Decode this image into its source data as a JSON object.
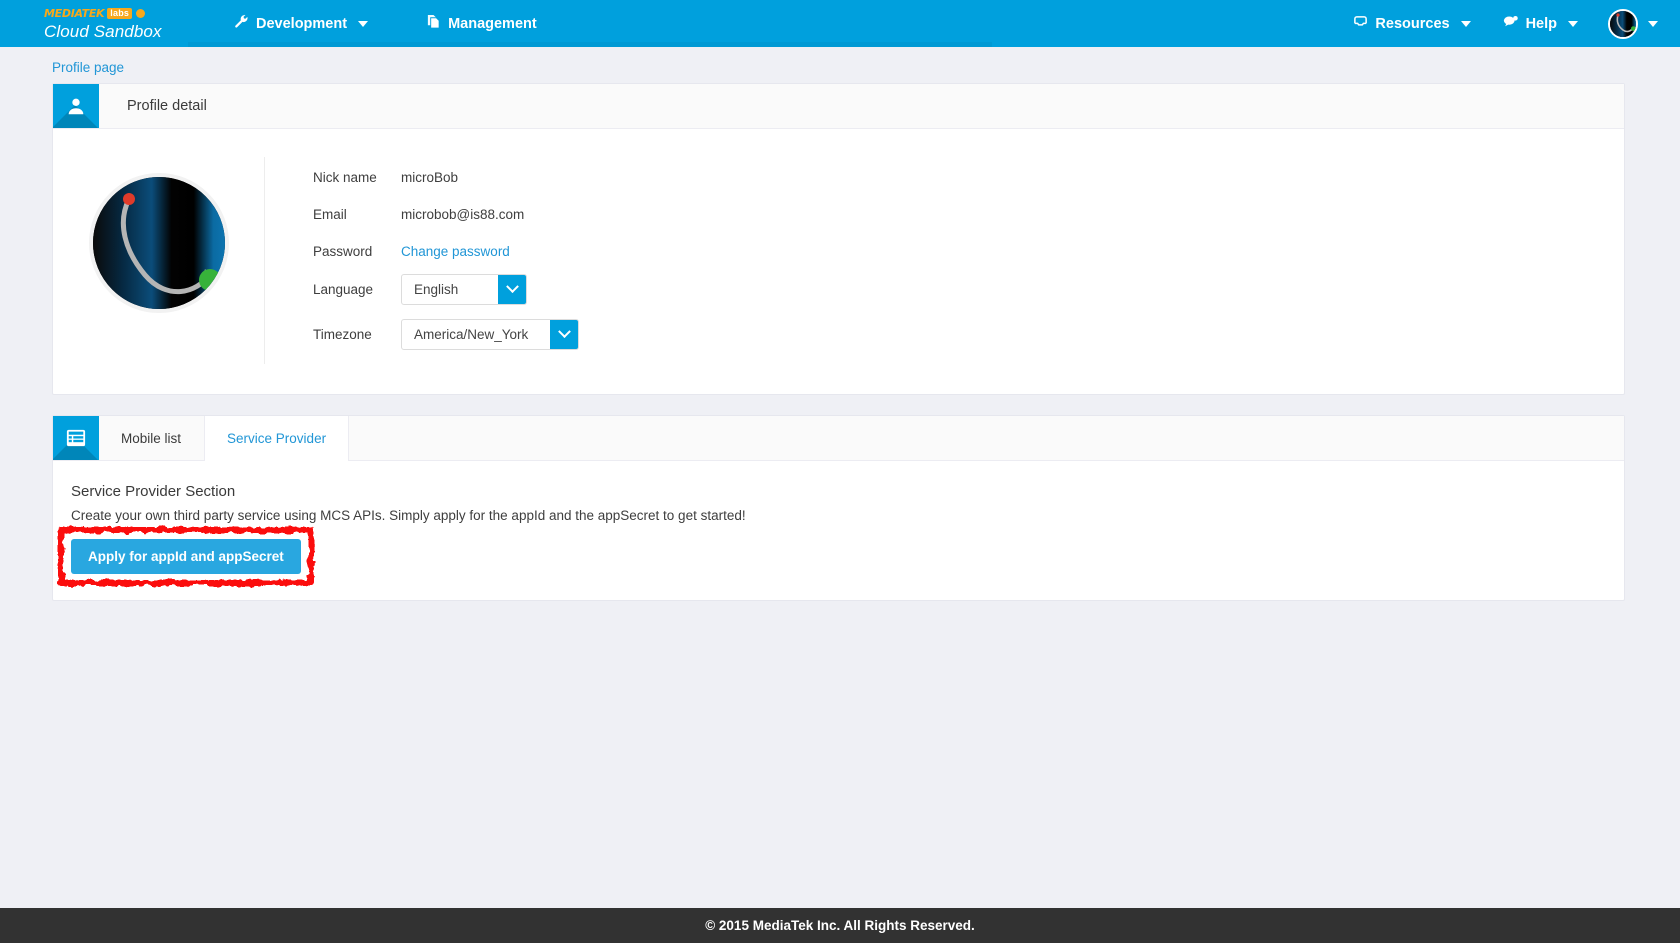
{
  "header": {
    "brand": {
      "mediatek": "MEDIATEK",
      "labs": "labs",
      "product": "Cloud Sandbox"
    },
    "nav_left": [
      {
        "label": "Development",
        "icon": "wrench-icon",
        "has_caret": true
      },
      {
        "label": "Management",
        "icon": "documents-icon",
        "has_caret": false
      }
    ],
    "nav_right": [
      {
        "label": "Resources",
        "icon": "inbox-icon",
        "has_caret": true
      },
      {
        "label": "Help",
        "icon": "chat-icon",
        "has_caret": true
      }
    ],
    "account": {
      "label": "",
      "has_caret": true
    }
  },
  "breadcrumb": {
    "label": "Profile page"
  },
  "profile_card": {
    "title": "Profile detail",
    "icon": "user-icon",
    "fields": [
      {
        "label": "Nick name",
        "type": "text",
        "value": "microBob"
      },
      {
        "label": "Email",
        "type": "text",
        "value": "microbob@is88.com"
      },
      {
        "label": "Password",
        "type": "link",
        "value": "Change password"
      },
      {
        "label": "Language",
        "type": "select",
        "value": "English"
      },
      {
        "label": "Timezone",
        "type": "select",
        "value": "America/New_York"
      }
    ]
  },
  "tabs_card": {
    "icon": "list-icon",
    "tabs": [
      {
        "label": "Mobile list",
        "active": false
      },
      {
        "label": "Service Provider",
        "active": true
      }
    ],
    "section": {
      "title": "Service Provider Section",
      "description": "Create your own third party service using MCS APIs. Simply apply for the appId and the appSecret to get started!",
      "button_label": "Apply for appId and appSecret",
      "annotation_color": "#fb0d0d"
    }
  },
  "footer": {
    "text": "© 2015 MediaTek Inc. All Rights Reserved."
  },
  "colors": {
    "brand_blue": "#00a0dd",
    "accent_orange": "#f7a81b",
    "link_blue": "#2196d6",
    "page_bg": "#eff0f5",
    "footer_bg": "#323232",
    "button_blue": "#29a7e0"
  }
}
